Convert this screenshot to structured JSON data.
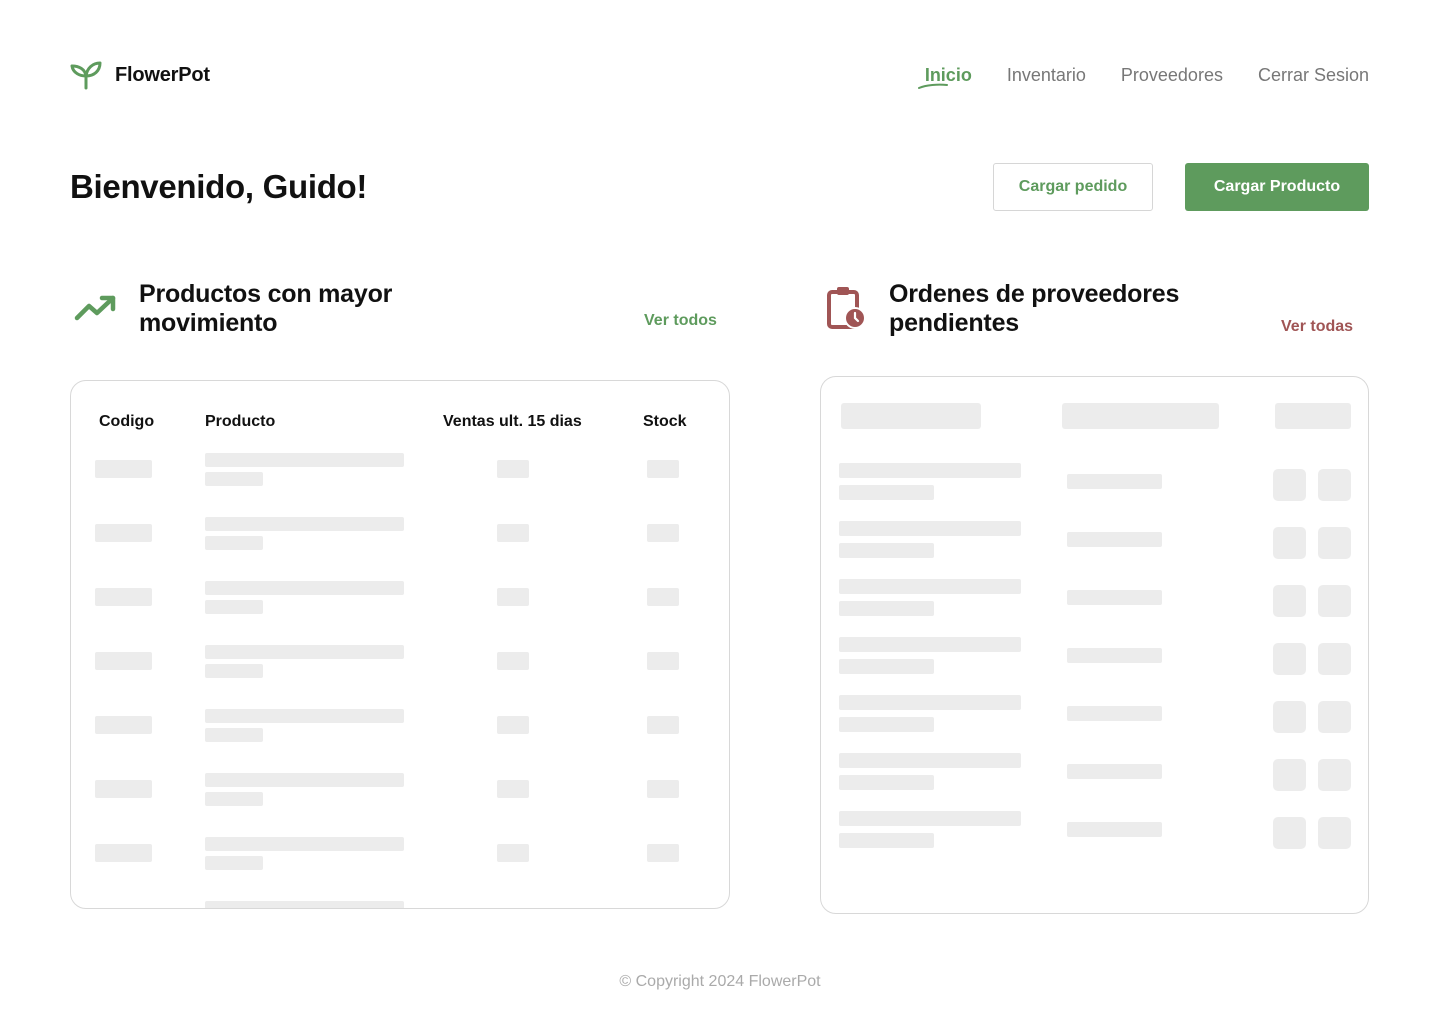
{
  "brand": {
    "name": "FlowerPot",
    "accent": "#5e9b5d"
  },
  "nav": [
    {
      "label": "Inicio",
      "active": true
    },
    {
      "label": "Inventario",
      "active": false
    },
    {
      "label": "Proveedores",
      "active": false
    },
    {
      "label": "Cerrar Sesion",
      "active": false
    }
  ],
  "welcome": {
    "title": "Bienvenido, Guido!"
  },
  "actions": {
    "secondary_label": "Cargar pedido",
    "primary_label": "Cargar Producto"
  },
  "top_products": {
    "icon": "trending-up-icon",
    "title_line1": "Productos con mayor",
    "title_line2": "movimiento",
    "link_label": "Ver todos",
    "columns": [
      "Codigo",
      "Producto",
      "Ventas ult. 15 dias",
      "Stock"
    ],
    "loading": true
  },
  "pending_orders": {
    "icon": "clipboard-clock-icon",
    "title_line1": "Ordenes de proveedores",
    "title_line2": "pendientes",
    "link_label": "Ver todas",
    "link_color": "#a05555",
    "loading": true
  },
  "footer": {
    "text": "© Copyright 2024  FlowerPot"
  }
}
